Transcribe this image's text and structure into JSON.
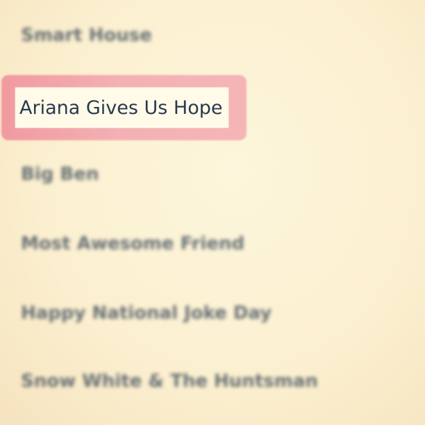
{
  "list": {
    "items": [
      {
        "label": "Smart House",
        "selected": false
      },
      {
        "label": "Ariana Gives Us Hope",
        "selected": true
      },
      {
        "label": "Big Ben",
        "selected": false
      },
      {
        "label": "Most Awesome Friend",
        "selected": false
      },
      {
        "label": "Happy National Joke Day",
        "selected": false
      },
      {
        "label": "Snow White & The Huntsman",
        "selected": false
      }
    ]
  },
  "colors": {
    "background": "#fbefcf",
    "selection_highlight": "#f4b1b4",
    "selected_text": "#283a4f",
    "item_text": "#4e5a66"
  }
}
